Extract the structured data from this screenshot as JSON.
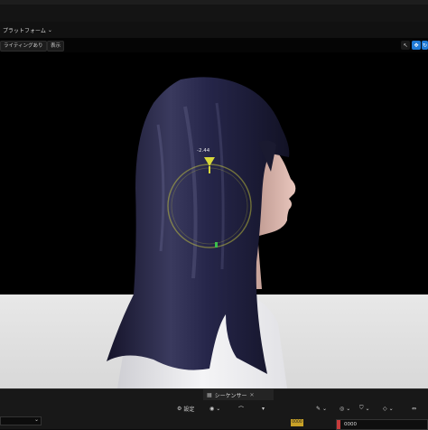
{
  "platform_menu": {
    "label": "プラットフォーム"
  },
  "viewport_toolbar": {
    "lighting_label": "ライティングあり",
    "show_label": "表示"
  },
  "gizmo": {
    "value": "-2.44"
  },
  "sequencer": {
    "tab_label": "シーケンサー",
    "settings_label": "設定",
    "frame_label": "0000",
    "timecode": "0000"
  },
  "colors": {
    "accent_blue": "#1f7ad6",
    "gizmo_yellow": "#d8d83a",
    "gizmo_green": "#3bbf4c"
  }
}
